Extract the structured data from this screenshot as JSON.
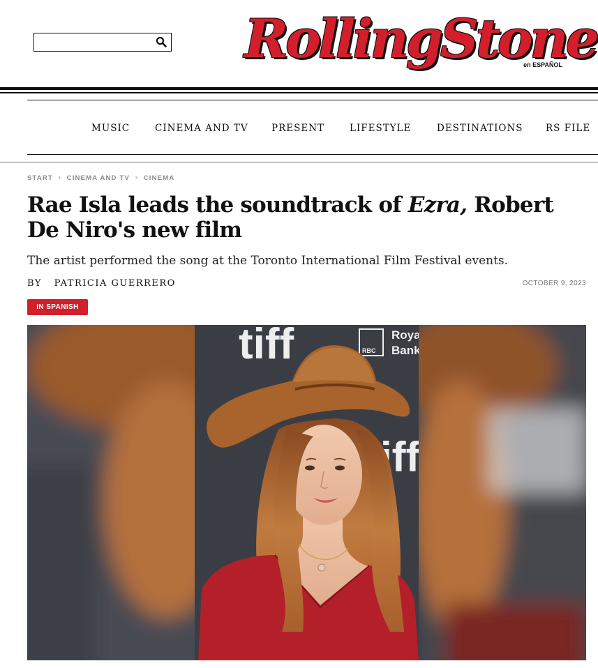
{
  "header": {
    "search": {
      "placeholder": "",
      "value": ""
    },
    "logo": {
      "text": "RollingStone",
      "edition": "en ESPAÑOL"
    }
  },
  "nav": {
    "items": [
      {
        "label": "MUSIC"
      },
      {
        "label": "CINEMA AND TV"
      },
      {
        "label": "PRESENT"
      },
      {
        "label": "LIFESTYLE"
      },
      {
        "label": "DESTINATIONS"
      },
      {
        "label": "RS FILE"
      }
    ]
  },
  "article": {
    "breadcrumb": [
      "START",
      "CINEMA AND TV",
      "CINEMA"
    ],
    "headline": {
      "before": "Rae Isla leads the soundtrack of ",
      "italic": "Ezra,",
      "after": " Robert De Niro's new film"
    },
    "dek": "The artist performed the song at the Toronto International Film Festival events.",
    "byline": {
      "by": "BY",
      "author": "PATRICIA GUERRERO"
    },
    "date": "OCTOBER 9, 2023",
    "badge": "IN SPANISH"
  },
  "hero": {
    "backdrop_text": [
      "tiff",
      "RBC",
      "Roya",
      "Bank",
      "tiff"
    ],
    "colors": {
      "hat": "#a8642c",
      "dress": "#b5212a",
      "hair": "#b56a33",
      "backdrop": "#3b3d45"
    }
  }
}
